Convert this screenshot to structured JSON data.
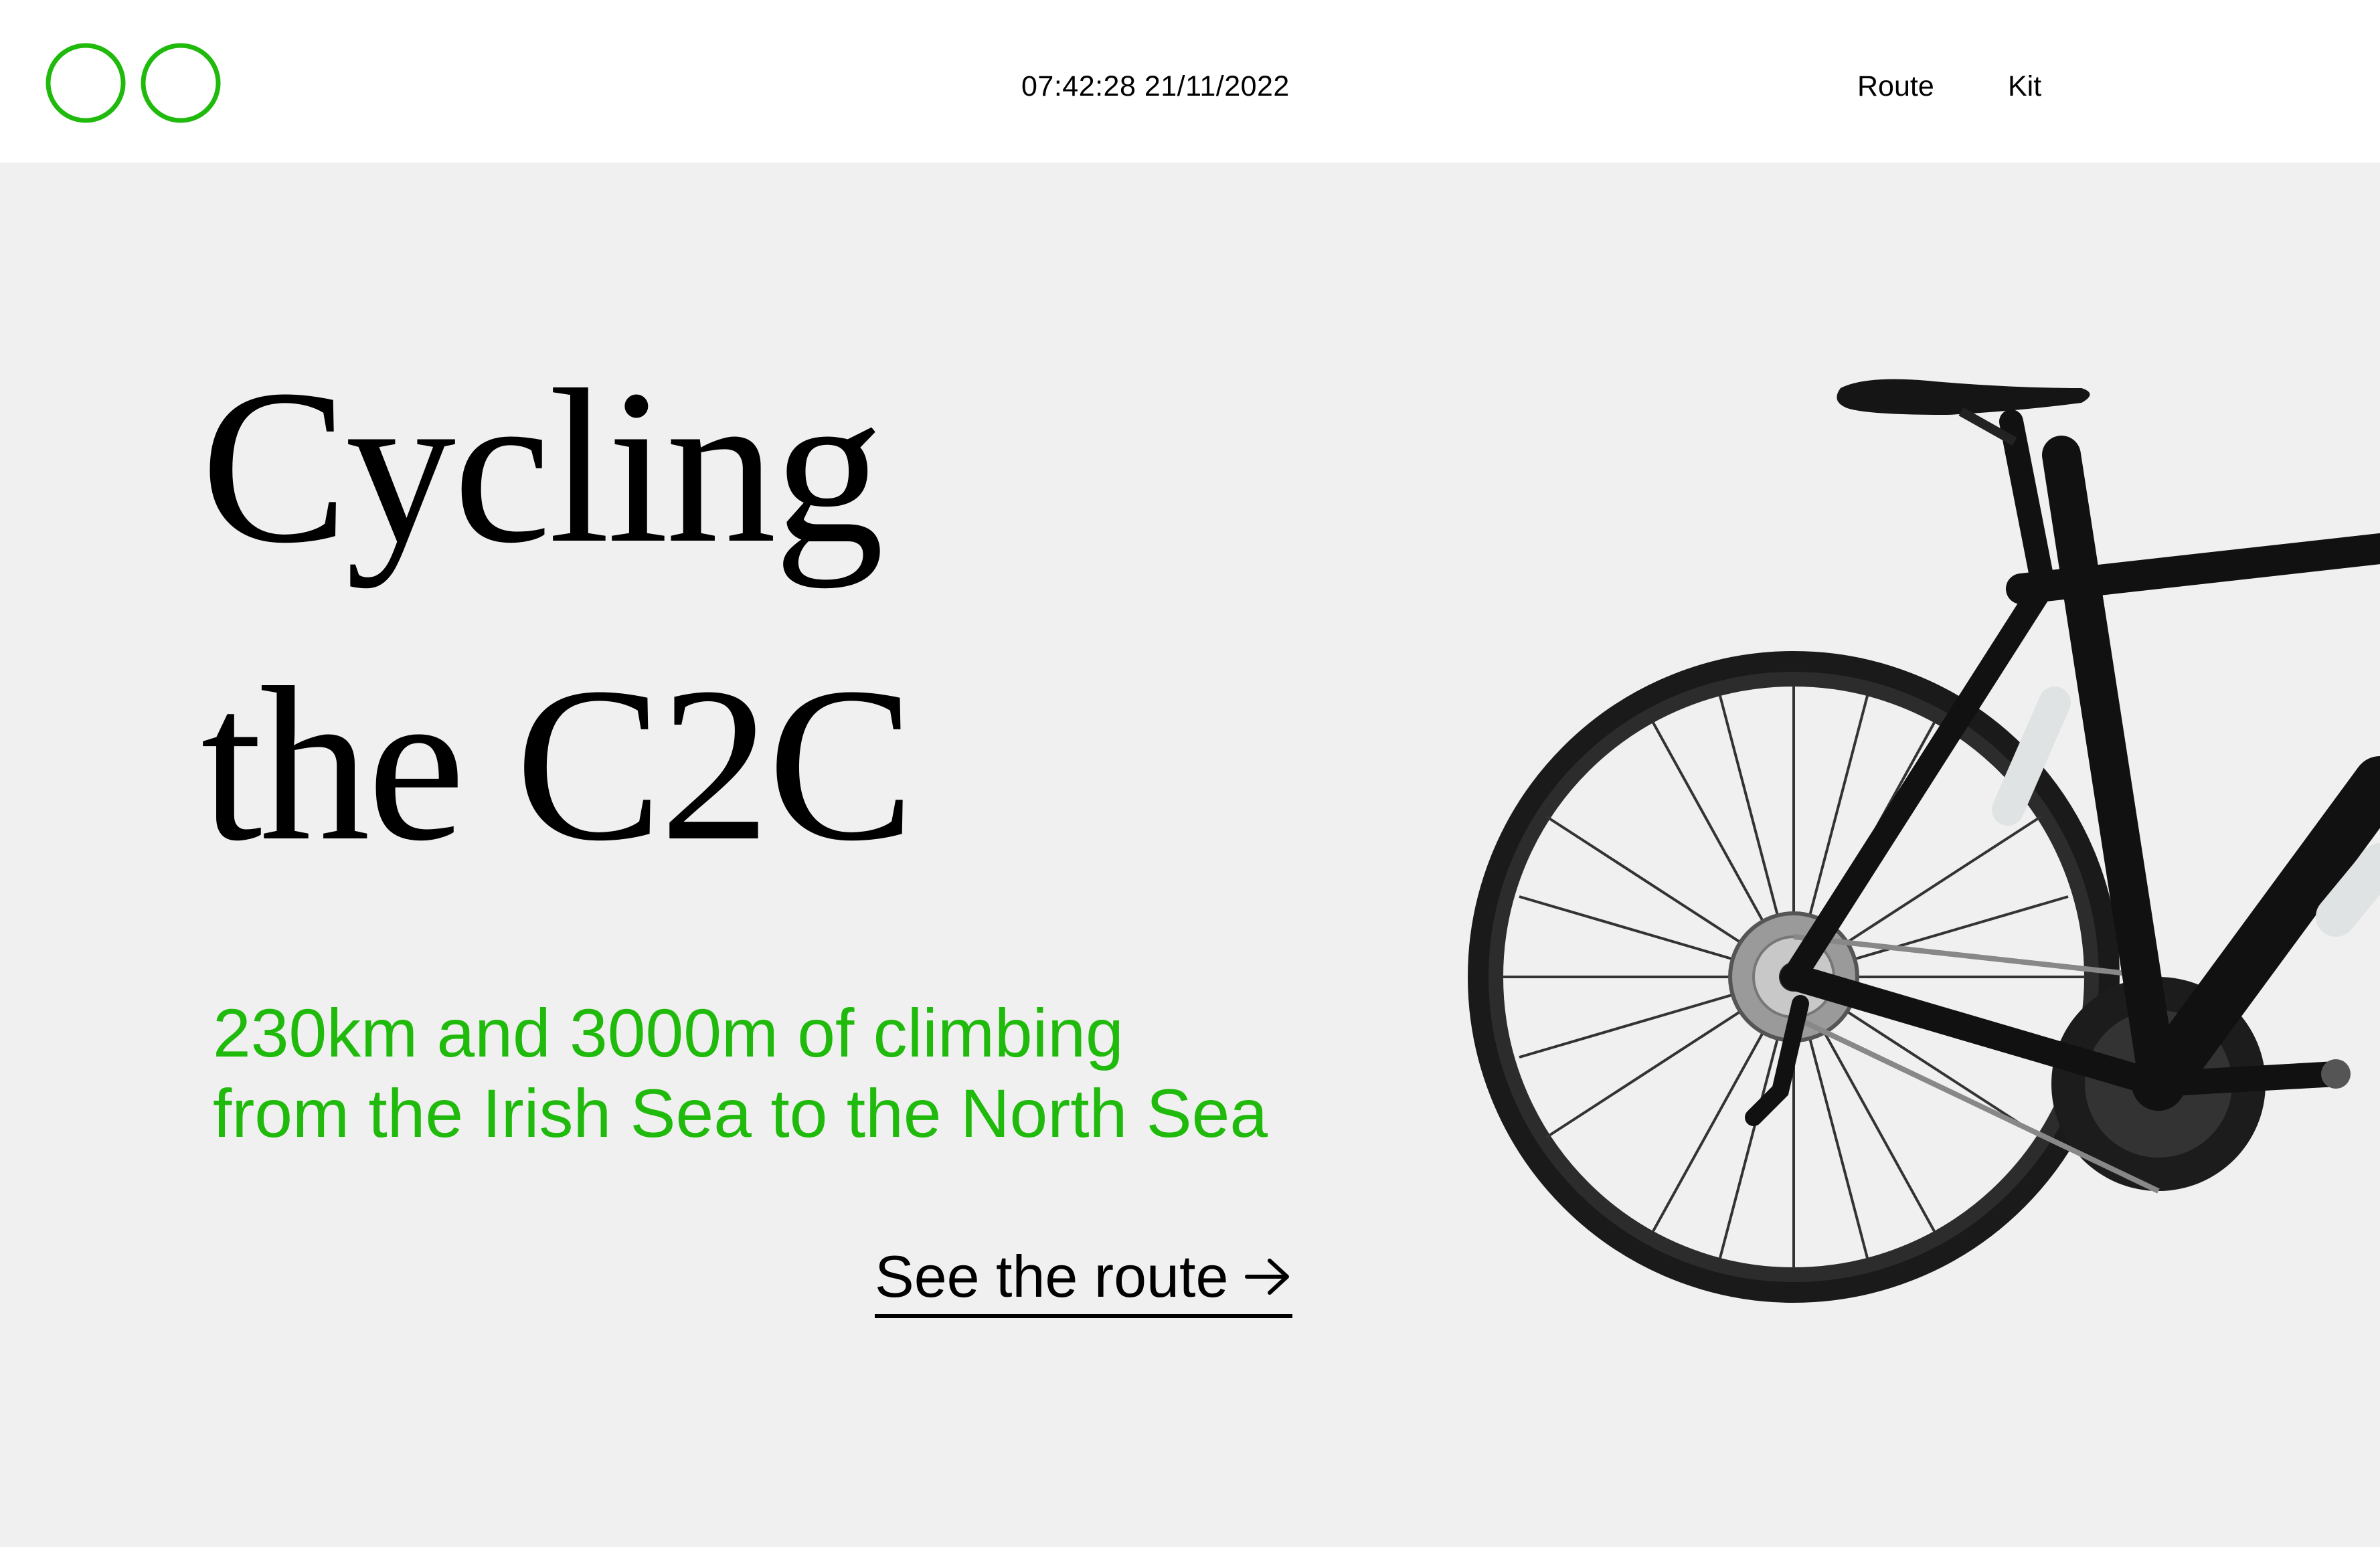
{
  "header": {
    "datetime": "07:42:28 21/11/2022",
    "nav": {
      "route_label": "Route",
      "kit_label": "Kit"
    }
  },
  "hero": {
    "title_line1": "Cycling",
    "title_line2": "the C2C",
    "subtitle_line1": "230km and 3000m of climbing",
    "subtitle_line2": "from the Irish Sea to the North Sea",
    "cta_label": "See the route",
    "cta_arrow": "→"
  },
  "colors": {
    "accent": "#1fba0b",
    "background": "#f1f0f0",
    "header_background": "#ffffff",
    "text": "#000000"
  },
  "icons": {
    "logo": "two-green-circles-logo",
    "cta": "arrow-right-icon",
    "image": "road-bike-illustration"
  }
}
